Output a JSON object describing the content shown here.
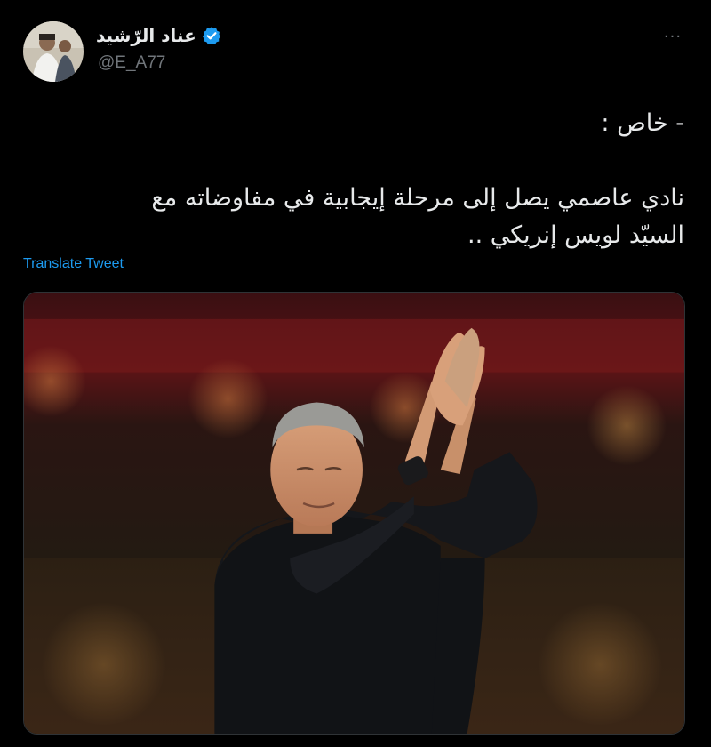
{
  "tweet": {
    "author": {
      "display_name": "عناد الرّشيد",
      "handle": "@E_A77",
      "verified": true
    },
    "more_label": "···",
    "text_lines": [
      "- خاص :",
      "نادي عاصمي يصل إلى مرحلة إيجابية في مفاوضاته مع",
      "السيّد لويس إنريكي .."
    ],
    "translate_label": "Translate Tweet"
  },
  "colors": {
    "background": "#000000",
    "text": "#e7e9ea",
    "secondary": "#71767b",
    "link": "#1d9bf0",
    "verified": "#1d9bf0"
  },
  "icons": {
    "verified": "verified-badge-icon",
    "more": "more-horizontal-icon"
  }
}
